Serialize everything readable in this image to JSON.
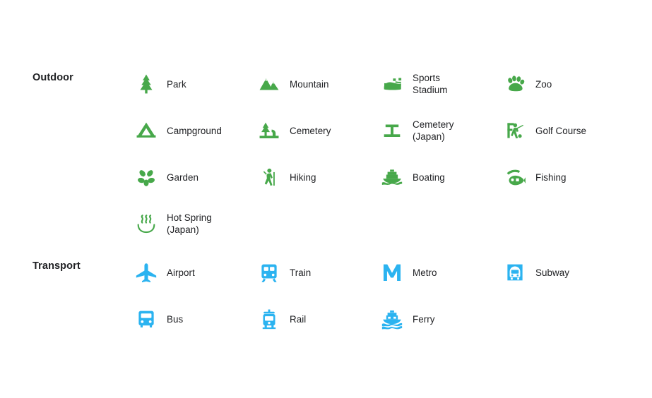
{
  "page": {
    "background_color": "#ffffff",
    "text_color": "#202124"
  },
  "sections": [
    {
      "label": "Outdoor",
      "accent_color": "#47a84a",
      "rows": [
        [
          {
            "icon": "pine-tree-icon",
            "label": "Park"
          },
          {
            "icon": "mountain-icon",
            "label": "Mountain"
          },
          {
            "icon": "sports-stadium-icon",
            "label": "Sports\nStadium"
          },
          {
            "icon": "paw-print-icon",
            "label": "Zoo"
          }
        ],
        [
          {
            "icon": "tent-icon",
            "label": "Campground"
          },
          {
            "icon": "cemetery-tree-icon",
            "label": "Cemetery"
          },
          {
            "icon": "cemetery-japan-icon",
            "label": "Cemetery\n(Japan)"
          },
          {
            "icon": "golfer-icon",
            "label": "Golf Course"
          }
        ],
        [
          {
            "icon": "flower-icon",
            "label": "Garden"
          },
          {
            "icon": "hiker-icon",
            "label": "Hiking"
          },
          {
            "icon": "boat-icon",
            "label": "Boating"
          },
          {
            "icon": "fish-icon",
            "label": "Fishing"
          }
        ],
        [
          {
            "icon": "hot-spring-icon",
            "label": "Hot Spring\n(Japan)"
          },
          {
            "icon": "",
            "label": ""
          },
          {
            "icon": "",
            "label": ""
          },
          {
            "icon": "",
            "label": ""
          }
        ]
      ]
    },
    {
      "label": "Transport",
      "accent_color": "#2bb3f0",
      "rows": [
        [
          {
            "icon": "airplane-icon",
            "label": "Airport"
          },
          {
            "icon": "train-icon",
            "label": "Train"
          },
          {
            "icon": "metro-m-icon",
            "label": "Metro"
          },
          {
            "icon": "subway-icon",
            "label": "Subway"
          }
        ],
        [
          {
            "icon": "bus-icon",
            "label": "Bus"
          },
          {
            "icon": "rail-tram-icon",
            "label": "Rail"
          },
          {
            "icon": "ferry-icon",
            "label": "Ferry"
          },
          {
            "icon": "",
            "label": ""
          }
        ]
      ]
    }
  ]
}
